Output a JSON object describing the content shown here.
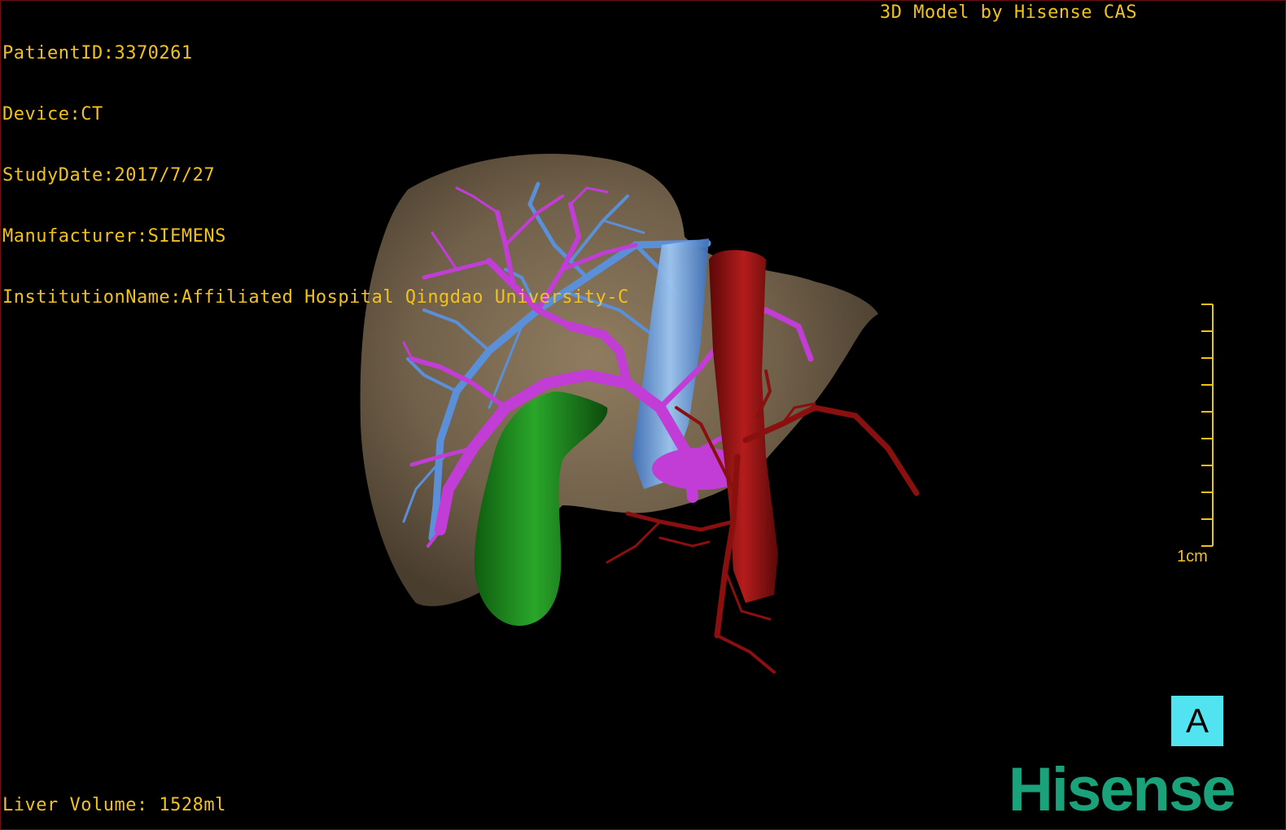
{
  "header": {
    "patient_id": "PatientID:3370261",
    "device": "Device:CT",
    "study_date": "StudyDate:2017/7/27",
    "manufacturer": "Manufacturer:SIEMENS",
    "institution": "InstitutionName:Affiliated Hospital Qingdao University-C",
    "model_credit": "3D Model by Hisense CAS"
  },
  "footer": {
    "liver_volume": "Liver Volume: 1528ml"
  },
  "scale_bar": {
    "label": "1cm"
  },
  "view_badge": "A",
  "logo_text": "Hisense",
  "colors": {
    "overlay_text": "#f2c21a",
    "liver": "#8a765a",
    "portal_vein": "#c23cd6",
    "hepatic_vein": "#5b8fd8",
    "artery_ivc": "#8a1010",
    "gallbladder": "#1f8a1f",
    "badge": "#52e3f0",
    "logo": "#1aa27a"
  }
}
